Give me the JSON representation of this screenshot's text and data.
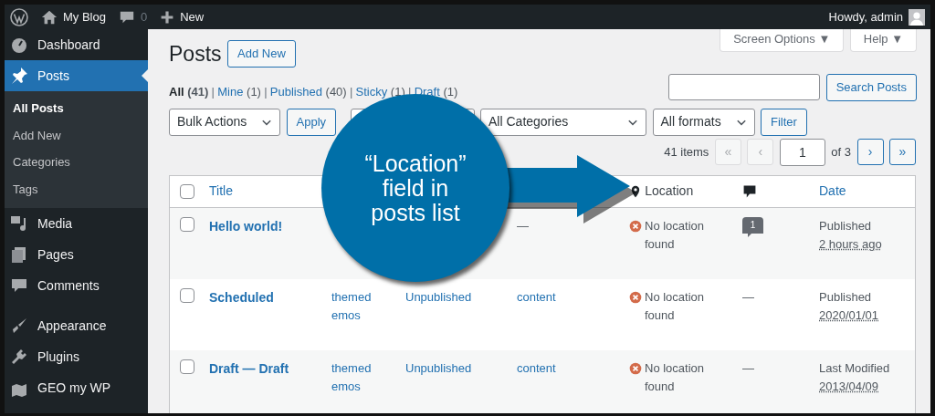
{
  "admin_bar": {
    "site_name": "My Blog",
    "comments_count": "0",
    "new_label": "New",
    "greeting": "Howdy, admin"
  },
  "sidebar": {
    "items": [
      {
        "label": "Dashboard",
        "selected": false
      },
      {
        "label": "Posts",
        "selected": true,
        "children": [
          {
            "label": "All Posts",
            "selected": true
          },
          {
            "label": "Add New",
            "selected": false
          },
          {
            "label": "Categories",
            "selected": false
          },
          {
            "label": "Tags",
            "selected": false
          }
        ]
      },
      {
        "label": "Media",
        "selected": false
      },
      {
        "label": "Pages",
        "selected": false
      },
      {
        "label": "Comments",
        "selected": false
      },
      {
        "label": "Appearance",
        "selected": false
      },
      {
        "label": "Plugins",
        "selected": false
      },
      {
        "label": "GEO my WP",
        "selected": false
      }
    ]
  },
  "screen_tabs": [
    {
      "label": "Screen Options",
      "caret": "▼"
    },
    {
      "label": "Help",
      "caret": "▼"
    }
  ],
  "page_title": "Posts",
  "add_new_button": "Add New",
  "views": [
    {
      "label": "All",
      "count": "(41)",
      "selected": true,
      "separator": "|"
    },
    {
      "label": "Mine",
      "count": "(1)",
      "selected": false,
      "separator": "|"
    },
    {
      "label": "Published",
      "count": "(40)",
      "selected": false,
      "separator": "|"
    },
    {
      "label": "Sticky",
      "count": "(1)",
      "selected": false,
      "separator": "|"
    },
    {
      "label": "Draft",
      "count": "(1)",
      "selected": false
    }
  ],
  "search_button": "Search Posts",
  "bulk_actions": "Bulk Actions",
  "apply_button": "Apply",
  "category_filter": "All Categories",
  "format_filter": "All formats",
  "filter_button": "Filter",
  "pagination": {
    "items": "41 items",
    "first": "«",
    "prev": "‹",
    "current_page": "1",
    "of_pages": "of 3",
    "next": "›",
    "last": "»"
  },
  "table": {
    "select_all_checked": false,
    "columns": [
      {
        "label": "Title",
        "kind": "link"
      },
      {
        "label": "Location",
        "kind": "labeled-icon"
      },
      {
        "kind": "icon"
      },
      {
        "label": "Date",
        "kind": "link"
      }
    ],
    "rows": [
      {
        "checked": false,
        "title": "Hello world!",
        "column_4": "—",
        "location": "No location found",
        "comments": {
          "kind": "bubble",
          "text": "1"
        },
        "date_status": "Published",
        "date_value": "2 hours ago"
      },
      {
        "checked": false,
        "title": "Scheduled",
        "column_2": "themedemos",
        "column_3": "Unpublished",
        "column_4": "content",
        "location": "No location found",
        "comments": {
          "kind": "dash",
          "text": "—"
        },
        "date_status": "Published",
        "date_value": "2020/01/01"
      },
      {
        "checked": false,
        "title": "Draft — Draft",
        "column_2": "themedemos",
        "column_3": "Unpublished",
        "column_4": "content",
        "location": "No location found",
        "comments": {
          "kind": "dash",
          "text": "—"
        },
        "date_status": "Last Modified",
        "date_value": "2013/04/09"
      }
    ]
  },
  "callout": {
    "text": "“Location” field in posts list"
  }
}
